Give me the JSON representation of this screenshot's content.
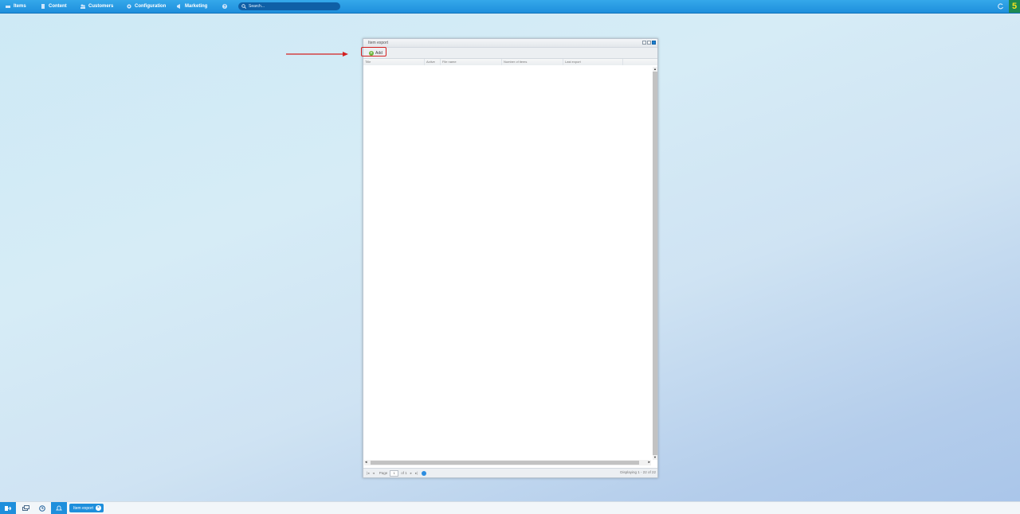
{
  "menubar": {
    "items": [
      {
        "label": "Items",
        "icon": "items-icon"
      },
      {
        "label": "Content",
        "icon": "content-icon"
      },
      {
        "label": "Customers",
        "icon": "customers-icon"
      },
      {
        "label": "Configuration",
        "icon": "configuration-icon"
      },
      {
        "label": "Marketing",
        "icon": "marketing-icon"
      }
    ],
    "search_placeholder": "Search...",
    "brand_letter": "5"
  },
  "window": {
    "title": "Item export",
    "toolbar": {
      "add_label": "Add"
    },
    "columns": [
      "Title",
      "Active",
      "File name",
      "Number of items",
      "Last export"
    ],
    "paging": {
      "page_label": "Page",
      "page_value": "1",
      "of_label": "of 1",
      "display": "Displaying 1 - 22 of 22"
    }
  },
  "taskbar": {
    "tab_label": "Item export"
  },
  "colors": {
    "menubar": "#1e8fdc",
    "highlight": "#d42020",
    "brand_bg": "#1d8a53",
    "brand_fg": "#f6e21c"
  }
}
